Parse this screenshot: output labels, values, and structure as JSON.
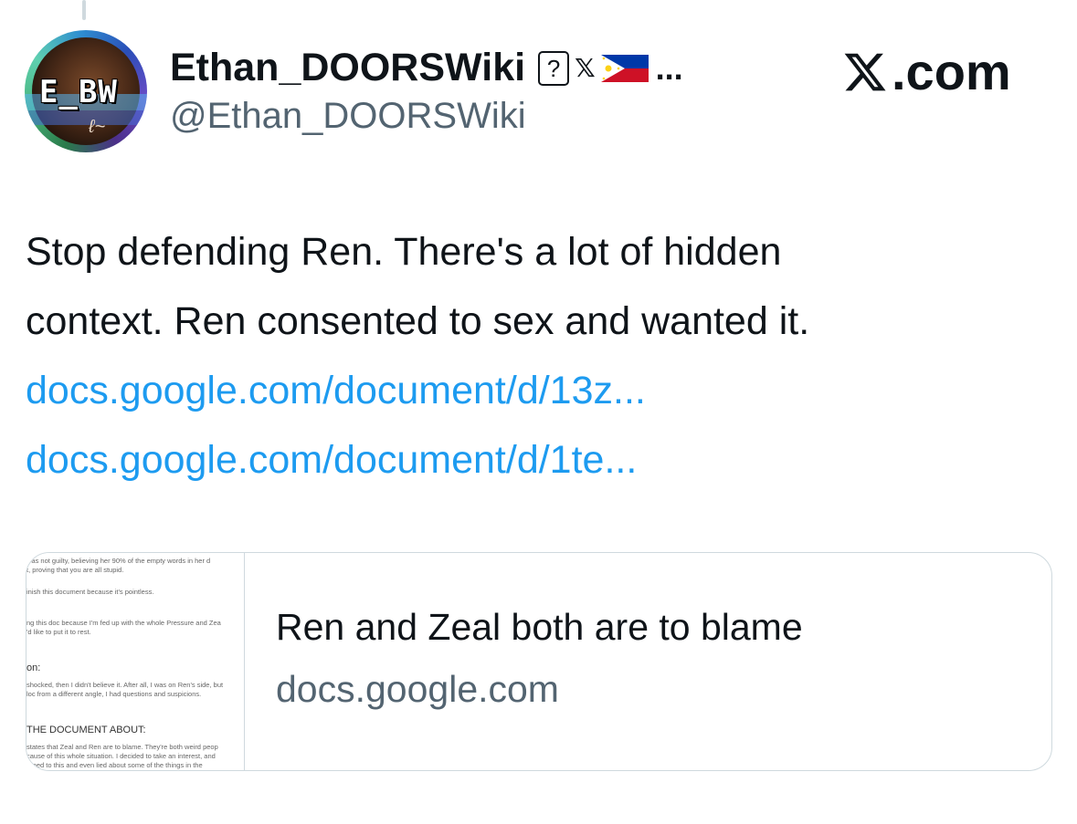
{
  "author": {
    "display_name": "Ethan_DOORSWiki",
    "badge_unknown": "?",
    "badge_x": "𝕏",
    "truncation": "...",
    "handle": "@Ethan_DOORSWiki",
    "avatar_text": "E_BW",
    "avatar_icon": "avatar-photo",
    "flag_icon": "philippines-flag-icon"
  },
  "source": {
    "logo": "𝕏",
    "text": ".com"
  },
  "tweet": {
    "lines": [
      "Stop defending Ren. There's a lot of hidden",
      "context. Ren consented to sex and wanted it."
    ],
    "links": [
      "docs.google.com/document/d/13z...",
      "docs.google.com/document/d/1te..."
    ]
  },
  "card": {
    "title": "Ren and Zeal both are to blame",
    "domain": "docs.google.com",
    "thumb_lines": [
      "was not guilty, believing her 90% of the empty words in her d",
      "t, proving that you are all stupid.",
      "inish this document because it's pointless.",
      "ng this doc because I'm fed up with the whole Pressure and Zea",
      "'d like to put it to rest.",
      "on:",
      "shocked, then I didn't believe it. After all, I was on Ren's side, but",
      "loc from a different angle, I had questions and suspicions.",
      "THE DOCUMENT ABOUT:",
      "states that Zeal and Ren are to blame. They're both weird peop",
      "cause of this whole situation. I decided to take an interest, and",
      "greed to this and even lied about some of the things in the"
    ]
  }
}
